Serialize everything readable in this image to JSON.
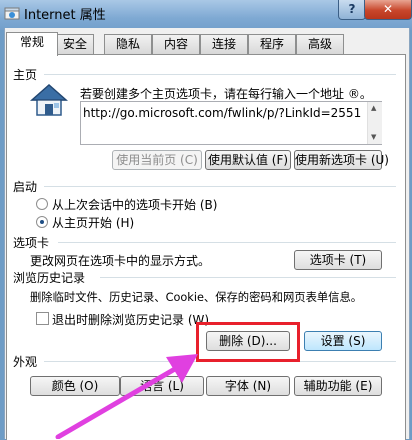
{
  "window": {
    "title": "Internet 属性",
    "help_label": "?",
    "close_label": "✕"
  },
  "tabs": [
    {
      "label": "常规",
      "active": true
    },
    {
      "label": "安全"
    },
    {
      "label": "隐私"
    },
    {
      "label": "内容"
    },
    {
      "label": "连接"
    },
    {
      "label": "程序"
    },
    {
      "label": "高级"
    }
  ],
  "homepage": {
    "heading": "主页",
    "description": "若要创建多个主页选项卡，请在每行输入一个地址 ®。",
    "url": "http://go.microsoft.com/fwlink/p/?LinkId=2551",
    "use_current": "使用当前页 (C)",
    "use_default": "使用默认值 (F)",
    "use_new_tab": "使用新选项卡 (U)"
  },
  "startup": {
    "heading": "启动",
    "option_restore": "从上次会话中的选项卡开始 (B)",
    "option_home": "从主页开始 (H)",
    "selected": "option_home"
  },
  "tabs_section": {
    "heading": "选项卡",
    "description": "更改网页在选项卡中的显示方式。",
    "button": "选项卡 (T)"
  },
  "history": {
    "heading": "浏览历史记录",
    "description": "删除临时文件、历史记录、Cookie、保存的密码和网页表单信息。",
    "checkbox_label": "退出时删除浏览历史记录 (W)",
    "checkbox_checked": false,
    "delete_button": "删除 (D)...",
    "settings_button": "设置 (S)"
  },
  "appearance": {
    "heading": "外观",
    "colors": "颜色 (O)",
    "languages": "语言 (L)",
    "fonts": "字体 (N)",
    "accessibility": "辅助功能 (E)"
  },
  "colors": {
    "annotation": "#e8202c",
    "arrow": "#e040e0"
  }
}
